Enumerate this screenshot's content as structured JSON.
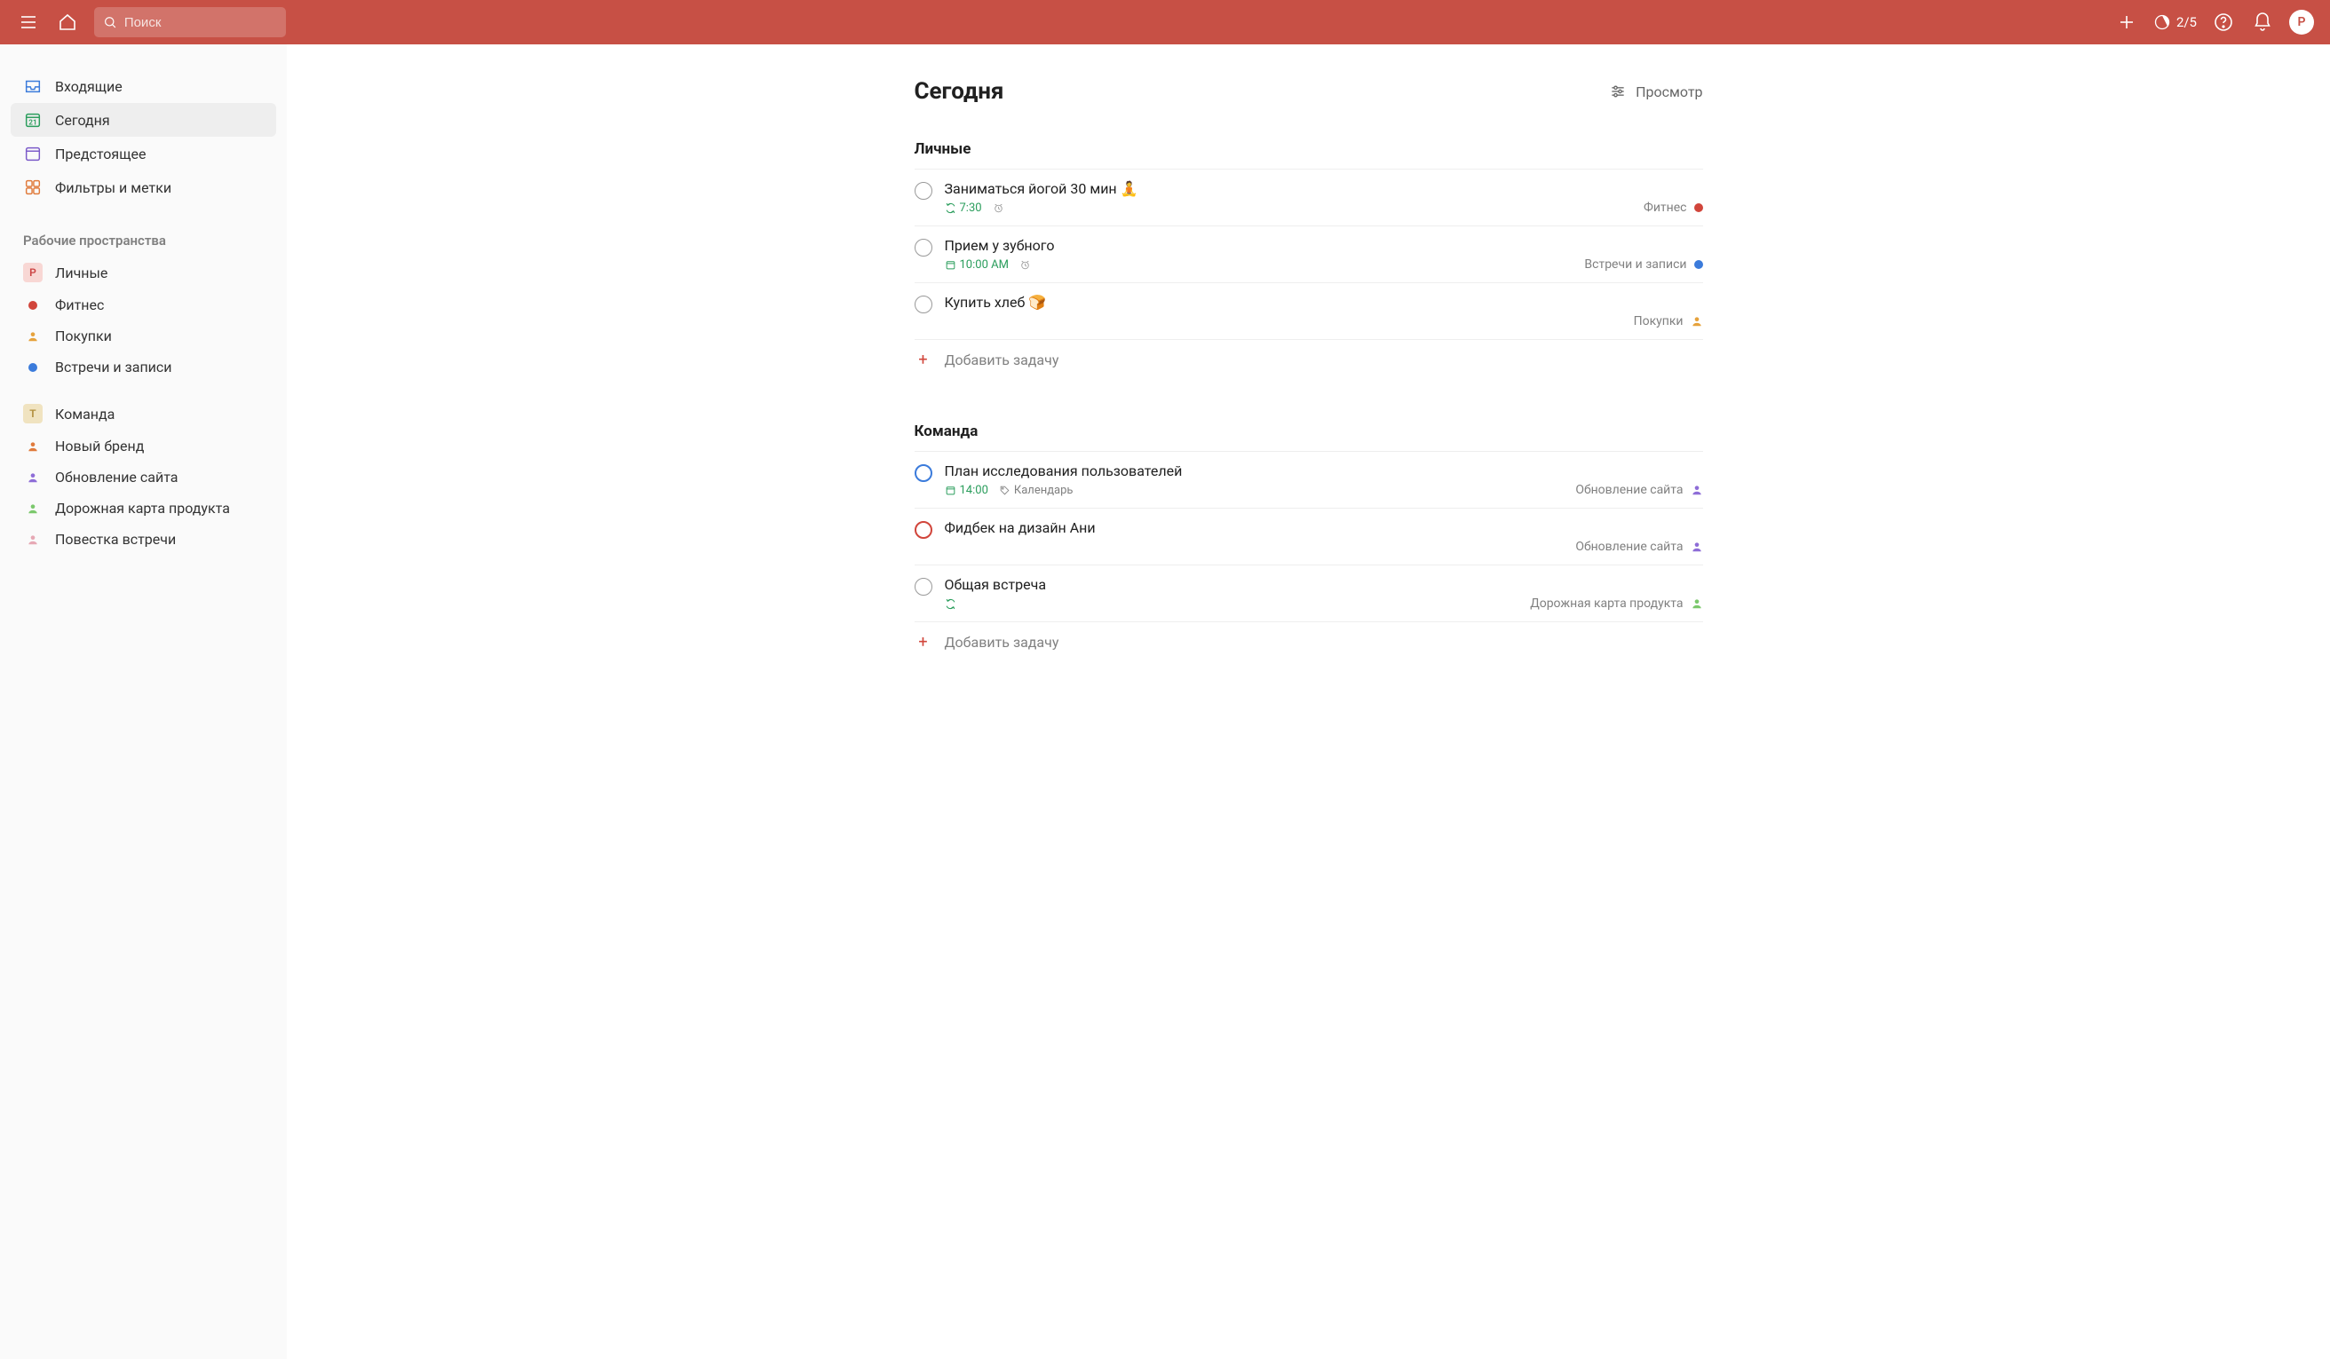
{
  "topbar": {
    "search_placeholder": "Поиск",
    "counter": "2/5",
    "avatar_letter": "P"
  },
  "sidebar": {
    "nav": [
      {
        "id": "inbox",
        "label": "Входящие"
      },
      {
        "id": "today",
        "label": "Сегодня"
      },
      {
        "id": "upcoming",
        "label": "Предстоящее"
      },
      {
        "id": "filters",
        "label": "Фильтры и метки"
      }
    ],
    "workspaces_title": "Рабочие пространства",
    "ws1": {
      "name": "Личные",
      "avatar": "P",
      "avatar_bg": "#f8d7d4",
      "avatar_color": "#c44",
      "projects": [
        {
          "label": "Фитнес",
          "color": "#d1453b"
        },
        {
          "label": "Покупки",
          "color": "#e6a23c"
        },
        {
          "label": "Встречи и записи",
          "color": "#3b7bdb"
        }
      ]
    },
    "ws2": {
      "name": "Команда",
      "avatar": "T",
      "avatar_bg": "#f0e3c0",
      "avatar_color": "#b08d3c",
      "projects": [
        {
          "label": "Новый бренд",
          "color": "#e07b3c"
        },
        {
          "label": "Обновление сайта",
          "color": "#8e6dd7"
        },
        {
          "label": "Дорожная карта продукта",
          "color": "#7bc86c"
        },
        {
          "label": "Повестка встречи",
          "color": "#e6a8b4"
        }
      ]
    }
  },
  "main": {
    "title": "Сегодня",
    "view_label": "Просмотр",
    "add_task_label": "Добавить задачу",
    "sections": [
      {
        "title": "Личные",
        "tasks": [
          {
            "title": "Заниматься йогой 30 мин 🧘",
            "priority": "normal",
            "recur": true,
            "time": "7:30",
            "alarm": true,
            "project": "Фитнес",
            "project_color": "#d1453b",
            "project_kind": "dot"
          },
          {
            "title": "Прием у зубного",
            "priority": "normal",
            "calendar": true,
            "time": "10:00 AM",
            "alarm": true,
            "project": "Встречи и записи",
            "project_color": "#3b7bdb",
            "project_kind": "dot"
          },
          {
            "title": "Купить хлеб 🍞",
            "priority": "normal",
            "project": "Покупки",
            "project_color": "#e6a23c",
            "project_kind": "person"
          }
        ]
      },
      {
        "title": "Команда",
        "tasks": [
          {
            "title": "План исследования пользователей",
            "priority": "p2",
            "calendar": true,
            "time": "14:00",
            "label": "Календарь",
            "project": "Обновление сайта",
            "project_color": "#8e6dd7",
            "project_kind": "person"
          },
          {
            "title": "Фидбек на дизайн Ани",
            "priority": "p1",
            "project": "Обновление сайта",
            "project_color": "#8e6dd7",
            "project_kind": "person"
          },
          {
            "title": "Общая встреча",
            "priority": "normal",
            "recur": true,
            "project": "Дорожная карта продукта",
            "project_color": "#7bc86c",
            "project_kind": "person"
          }
        ]
      }
    ]
  }
}
